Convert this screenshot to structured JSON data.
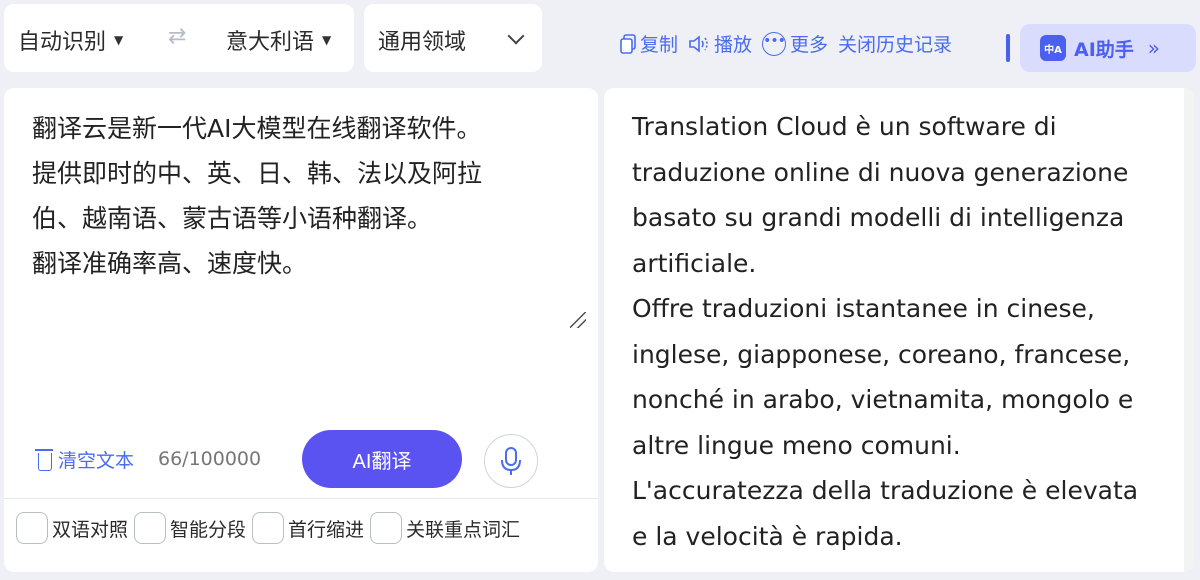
{
  "lang_bar": {
    "source_lang": "自动识别",
    "swap_icon": "swap-arrows",
    "target_lang": "意大利语"
  },
  "domain": {
    "label": "通用领域"
  },
  "toolbar": {
    "copy": "复制",
    "play": "播放",
    "more": "更多",
    "close_history": "关闭历史记录",
    "ai_helper": "AI助手",
    "ai_avatar_text": "中A"
  },
  "source": {
    "text": "翻译云是新一代AI大模型在线翻译软件。\n提供即时的中、英、日、韩、法以及阿拉\n伯、越南语、蒙古语等小语种翻译。\n翻译准确率高、速度快。",
    "clear_label": "清空文本",
    "char_count": "66/100000",
    "translate_label": "AI翻译",
    "options": [
      "双语对照",
      "智能分段",
      "首行缩进",
      "关联重点词汇"
    ]
  },
  "target": {
    "lines": [
      "Translation Cloud è un software di",
      "traduzione online di nuova generazione",
      "basato su grandi modelli di intelligenza",
      "artificiale.",
      "Offre traduzioni istantanee in cinese,",
      "inglese, giapponese, coreano, francese,",
      "nonché in arabo, vietnamita, mongolo e",
      "altre lingue meno comuni.",
      "L'accuratezza della traduzione è elevata",
      "e la velocità è rapida."
    ]
  },
  "colors": {
    "accent": "#4a6cf0",
    "button": "#5b52f2",
    "ai_helper_bg": "#d9dcfc",
    "page_bg": "#eef0f6"
  }
}
